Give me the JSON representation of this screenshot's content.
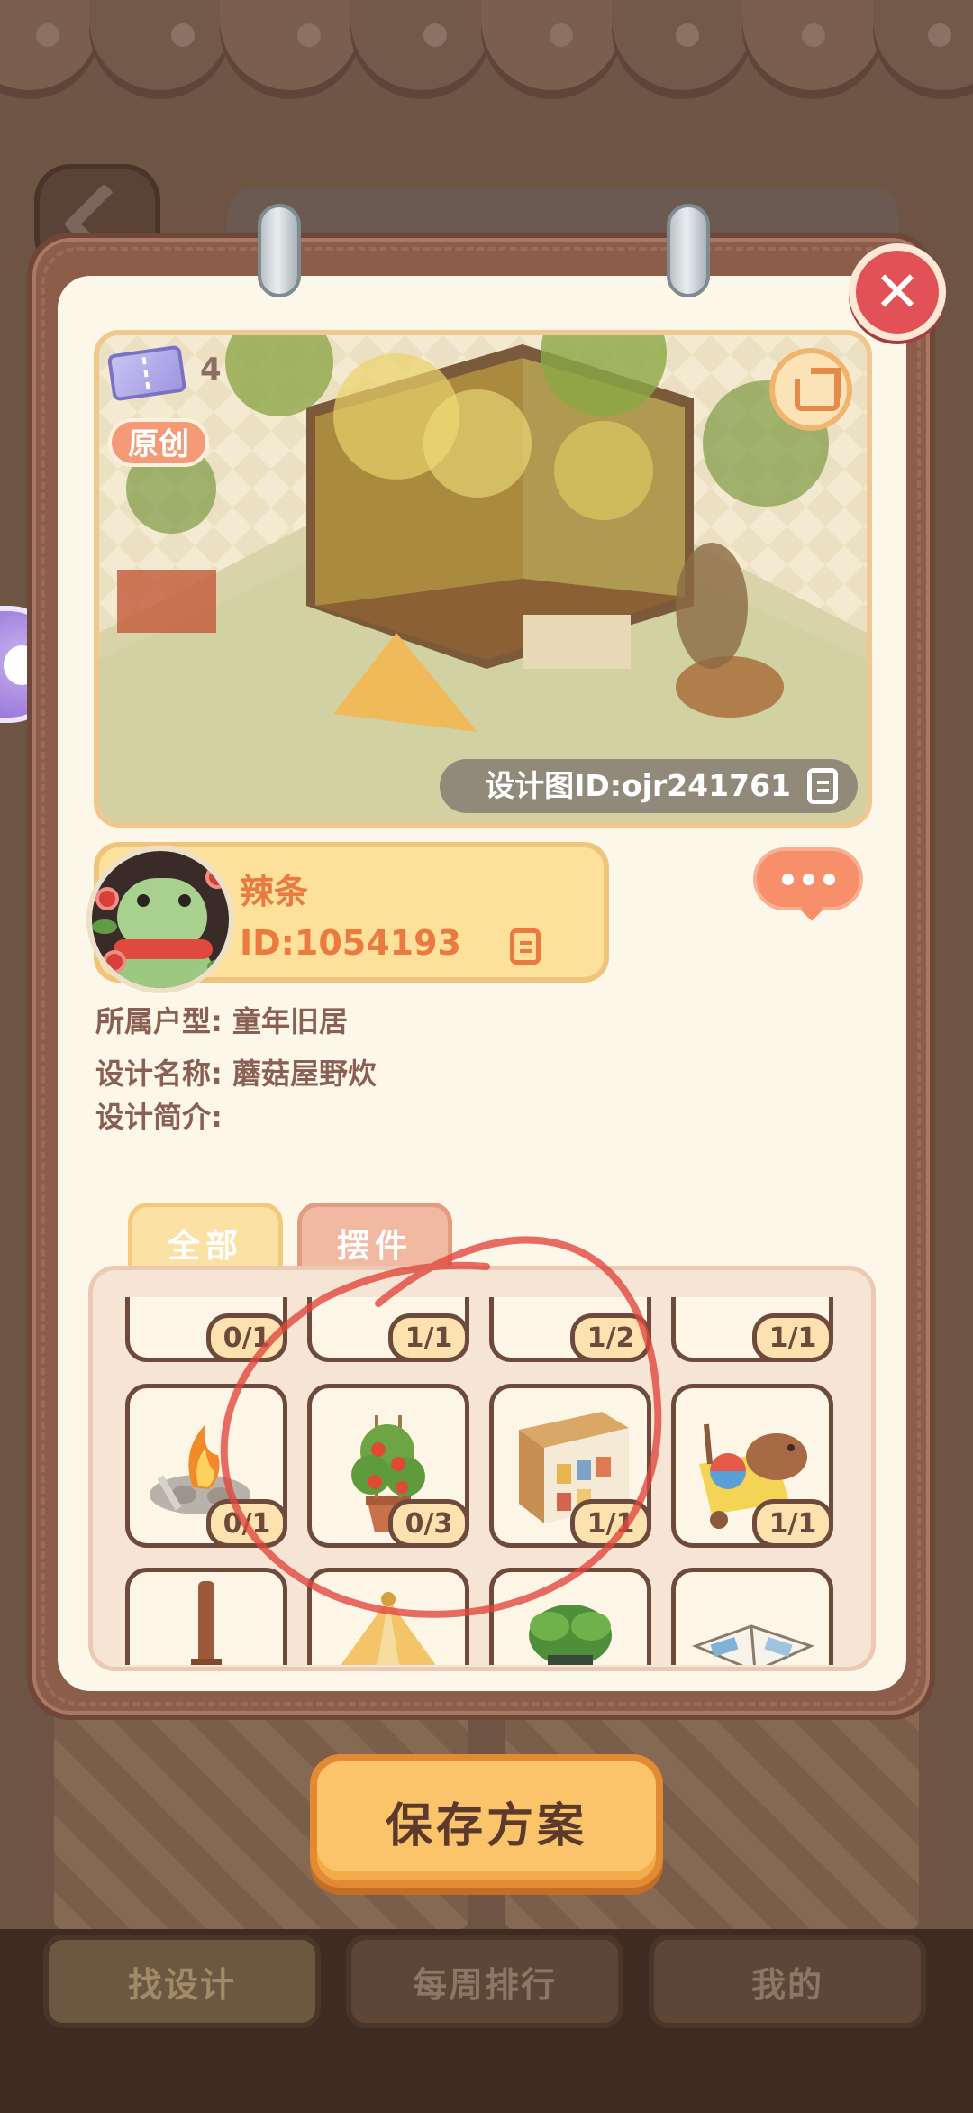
{
  "preview": {
    "ticket_count": "4",
    "original_badge": "原创",
    "design_id": "设计图ID:ojr241761"
  },
  "author": {
    "name": "辣条",
    "id": "ID:1054193"
  },
  "info": {
    "house_type": "所属户型: 童年旧居",
    "design_name": "设计名称: 蘑菇屋野炊",
    "design_intro": "设计简介:"
  },
  "tabs": {
    "all": "全部",
    "items": "摆件"
  },
  "grid": {
    "row1": [
      {
        "icon": "cake-plate",
        "count": "0/1"
      },
      {
        "icon": "food-plate",
        "count": "1/1"
      },
      {
        "icon": "tent-cloth",
        "count": "1/2"
      },
      {
        "icon": "wooden-rack",
        "count": "1/1"
      }
    ],
    "row2": [
      {
        "icon": "campfire",
        "count": "0/1"
      },
      {
        "icon": "tomato-plant",
        "count": "0/3"
      },
      {
        "icon": "food-cabinet",
        "count": "1/1"
      },
      {
        "icon": "capybara-toy-cart",
        "count": "1/1"
      }
    ],
    "row3": [
      {
        "icon": "wooden-post"
      },
      {
        "icon": "tent"
      },
      {
        "icon": "potted-plant"
      },
      {
        "icon": "open-book"
      }
    ]
  },
  "save_button": "保存方案",
  "bottom_nav": {
    "find_design": "找设计",
    "weekly_rank": "每周排行",
    "mine": "我的"
  }
}
